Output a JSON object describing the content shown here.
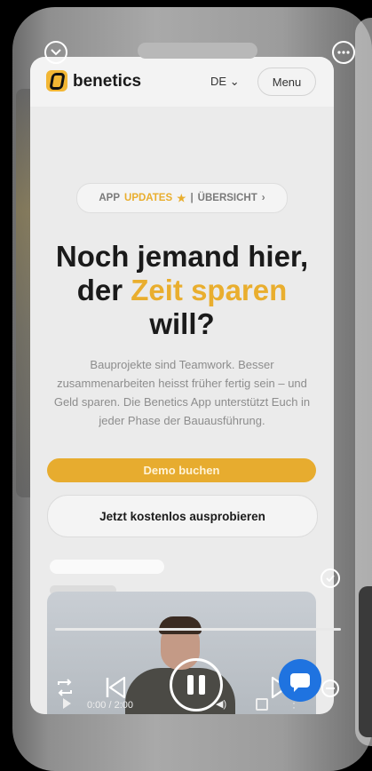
{
  "site": {
    "brand": "benetics",
    "language": "DE",
    "language_caret": "⌄",
    "menu_label": "Menu"
  },
  "badge": {
    "part1": "APP",
    "part2": "UPDATES",
    "star": "★",
    "separator": "|",
    "part3": "ÜBERSICHT",
    "arrow": "›"
  },
  "hero": {
    "line1": "Noch jemand hier,",
    "line2_a": "der ",
    "line2_b": "Zeit sparen",
    "line3": "will?",
    "body": "Bauprojekte sind Teamwork. Besser zusammenarbeiten heisst früher fertig sein – und Geld sparen. Die Benetics App unterstützt Euch in jeder Phase der Bauausführung."
  },
  "buttons": {
    "demo": "Demo buchen",
    "try": "Jetzt kostenlos ausprobieren"
  },
  "video": {
    "time": "0:00 / 2:00"
  },
  "colors": {
    "accent": "#e9ae2e",
    "chat": "#1f73e0"
  }
}
